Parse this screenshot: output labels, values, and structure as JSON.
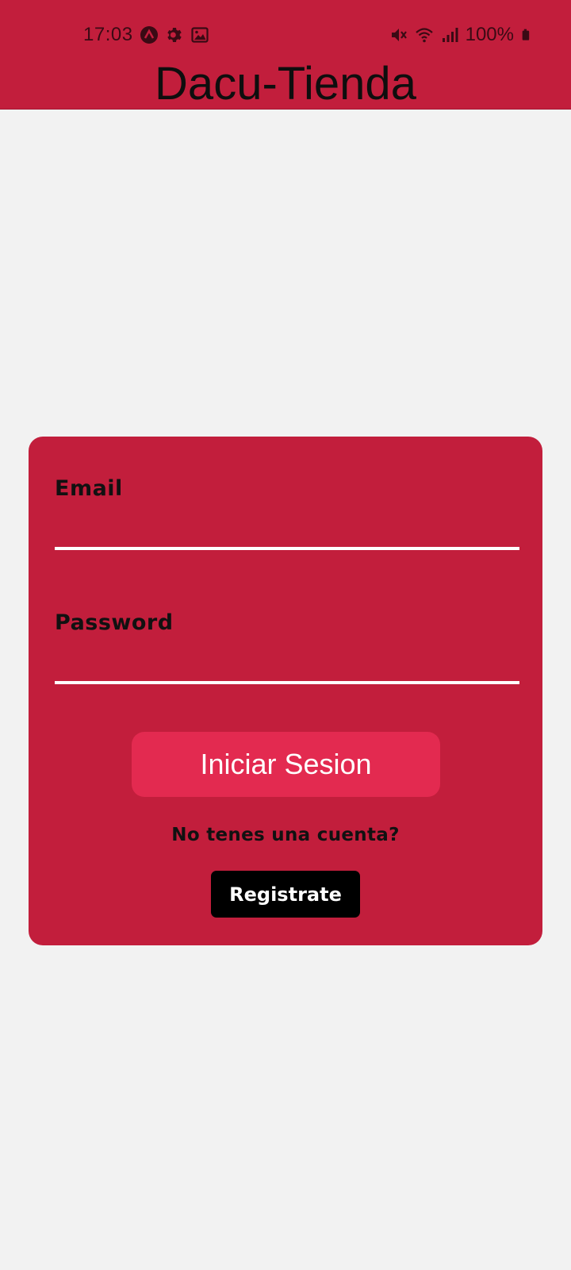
{
  "status_bar": {
    "time": "17:03",
    "battery": "100%",
    "left_icons": [
      "app-a-icon",
      "gear-icon",
      "image-icon"
    ],
    "right_icons": [
      "mute-icon",
      "wifi-icon",
      "signal-icon",
      "battery-icon"
    ]
  },
  "app": {
    "title": "Dacu-Tienda"
  },
  "login_form": {
    "email_label": "Email",
    "email_value": "",
    "password_label": "Password",
    "password_value": "",
    "submit_label": "Iniciar Sesion",
    "no_account_text": "No tenes una cuenta?",
    "register_label": "Registrate"
  },
  "colors": {
    "primary": "#C21E3C",
    "button_accent": "#E32A50",
    "background": "#F2F2F2",
    "register_button": "#000000"
  }
}
